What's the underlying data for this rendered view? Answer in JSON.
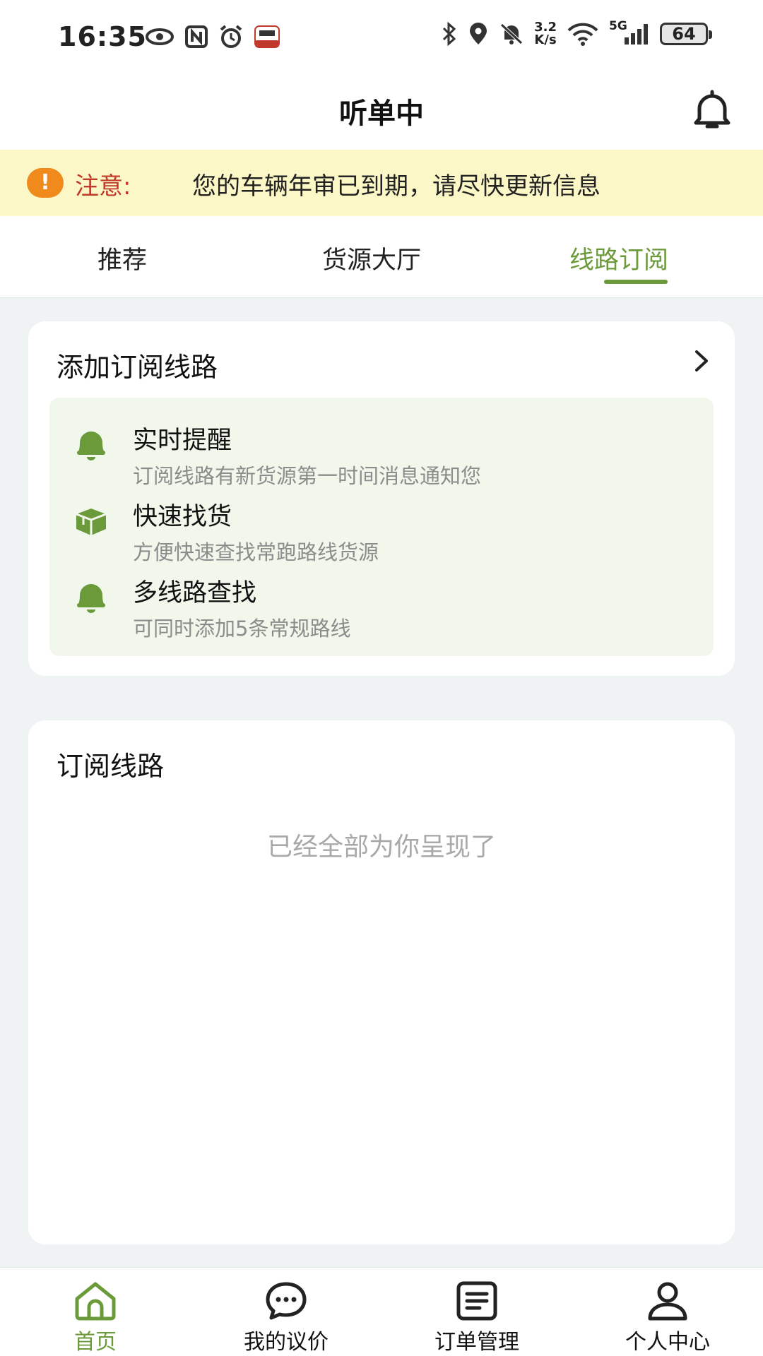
{
  "status_bar": {
    "time": "16:35",
    "net_speed_value": "3.2",
    "net_speed_unit": "K/s",
    "network": "5G",
    "battery": "64"
  },
  "header": {
    "title": "听单中"
  },
  "notice": {
    "label": "注意:",
    "message": "您的车辆年审已到期，请尽快更新信息"
  },
  "tabs": [
    {
      "label": "推荐",
      "active": false
    },
    {
      "label": "货源大厅",
      "active": false
    },
    {
      "label": "线路订阅",
      "active": true
    }
  ],
  "add_subscription": {
    "title": "添加订阅线路",
    "features": [
      {
        "icon": "bell-icon",
        "title": "实时提醒",
        "desc": "订阅线路有新货源第一时间消息通知您"
      },
      {
        "icon": "box-icon",
        "title": "快速找货",
        "desc": "方便快速查找常跑路线货源"
      },
      {
        "icon": "bell-icon",
        "title": "多线路查找",
        "desc": "可同时添加5条常规路线"
      }
    ]
  },
  "subscribed_routes": {
    "title": "订阅线路",
    "empty_text": "已经全部为你呈现了"
  },
  "bottom_nav": [
    {
      "label": "首页",
      "icon": "home-icon",
      "active": true
    },
    {
      "label": "我的议价",
      "icon": "chat-icon",
      "active": false
    },
    {
      "label": "订单管理",
      "icon": "list-icon",
      "active": false
    },
    {
      "label": "个人中心",
      "icon": "user-icon",
      "active": false
    }
  ],
  "colors": {
    "accent": "#6b9a3a",
    "notice_bg": "#fbf7c6",
    "notice_label": "#c0392b",
    "warning_icon": "#f08a1c"
  }
}
